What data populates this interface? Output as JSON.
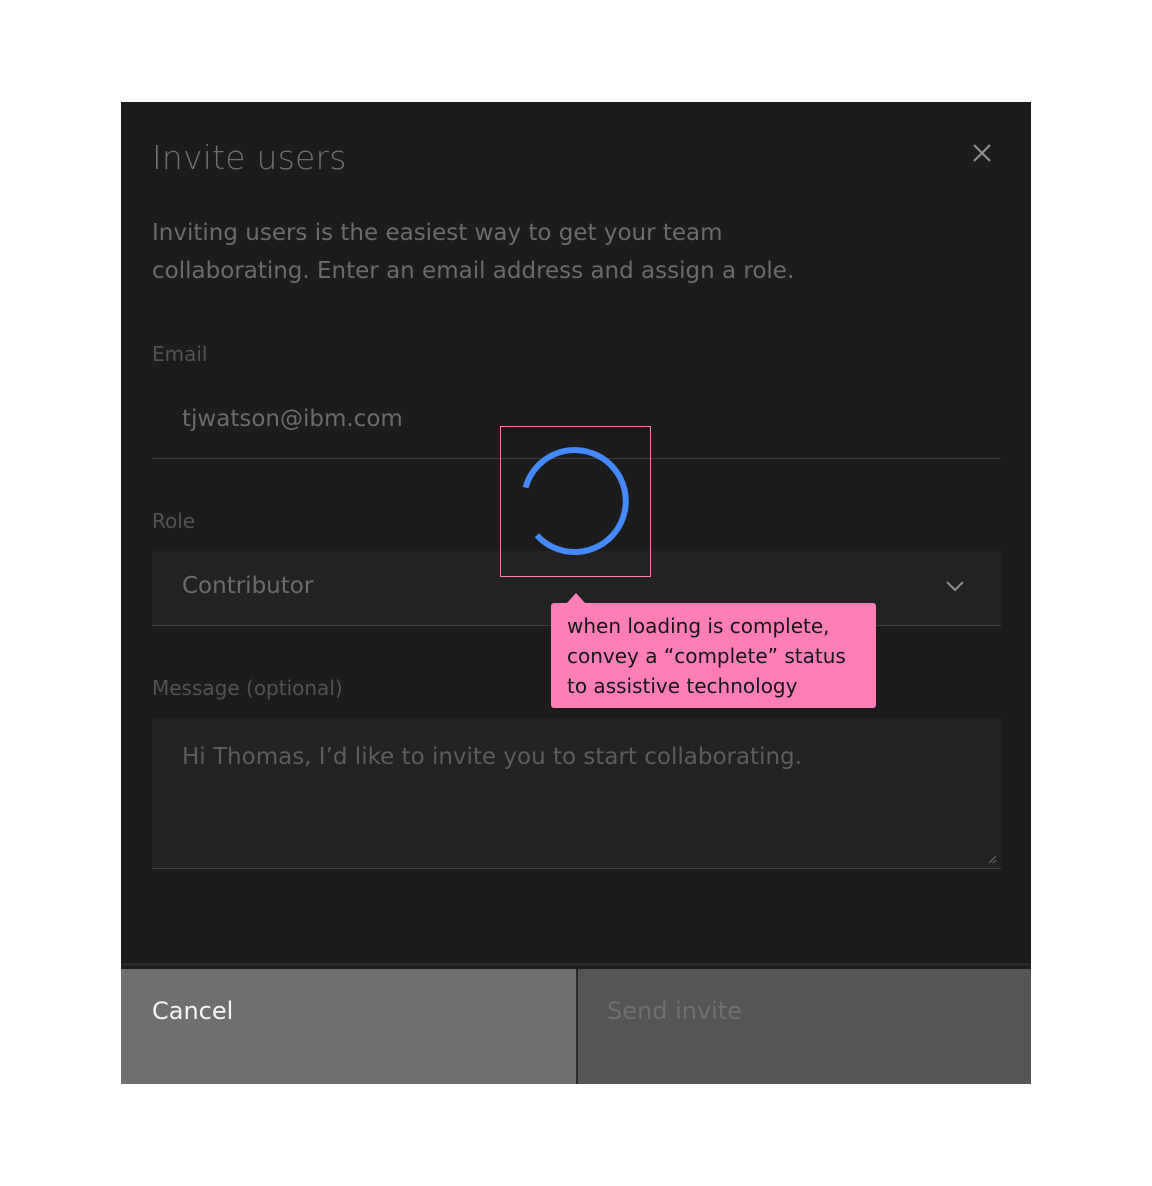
{
  "modal": {
    "title": "Invite users",
    "description": "Inviting users is the easiest way to get your team collaborating. Enter an email address and assign a role.",
    "close_icon": "close-icon"
  },
  "form": {
    "email": {
      "label": "Email",
      "value": "tjwatson@ibm.com"
    },
    "role": {
      "label": "Role",
      "value": "Contributor",
      "icon": "chevron-down-icon"
    },
    "message": {
      "label": "Message (optional)",
      "value": "Hi Thomas, I’d like to invite you to start collaborating."
    }
  },
  "footer": {
    "cancel_label": "Cancel",
    "send_label": "Send invite"
  },
  "annotation": {
    "lines": [
      "when loading is complete,",
      "convey a “complete” status",
      "to assistive technology"
    ]
  },
  "colors": {
    "modal_bg": "#1c1c1c",
    "spinner": "#4589ff",
    "annotation": "#ff7eb6",
    "cancel_bg": "#6f6f6f",
    "send_bg": "#555555"
  }
}
